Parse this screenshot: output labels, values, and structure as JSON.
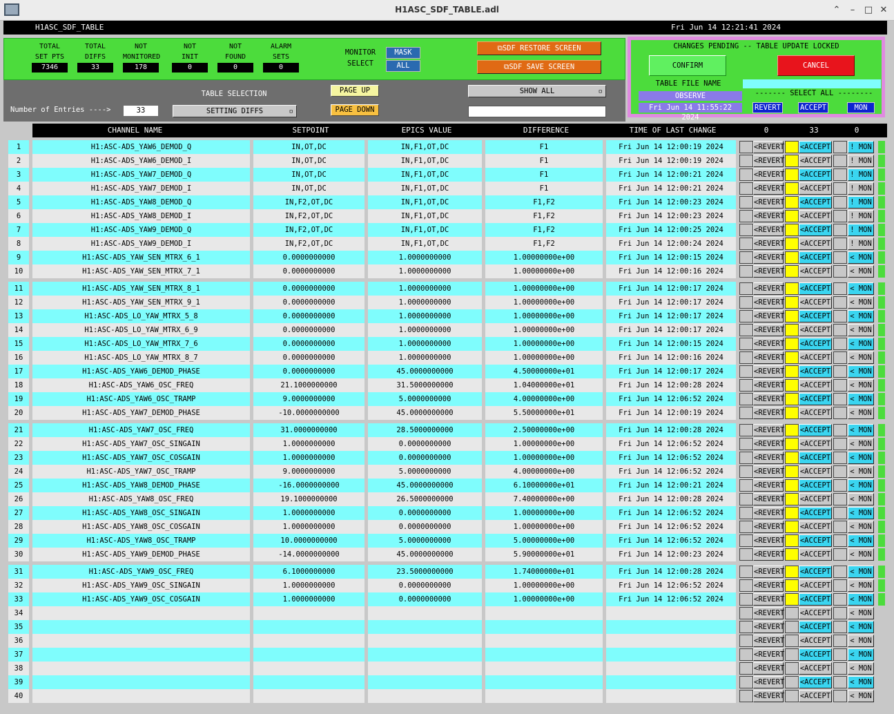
{
  "window": {
    "title": "H1ASC_SDF_TABLE.adl"
  },
  "header": {
    "screen_name": "H1ASC_SDF_TABLE",
    "datetime": "Fri Jun 14 12:21:41 2024"
  },
  "counts": [
    {
      "label1": "TOTAL",
      "label2": "SET PTS",
      "value": "7346"
    },
    {
      "label1": "TOTAL",
      "label2": "DIFFS",
      "value": "33"
    },
    {
      "label1": "NOT",
      "label2": "MONITORED",
      "value": "178"
    },
    {
      "label1": "NOT",
      "label2": "INIT",
      "value": "0"
    },
    {
      "label1": "NOT",
      "label2": "FOUND",
      "value": "0"
    },
    {
      "label1": "ALARM",
      "label2": "SETS",
      "value": "0"
    }
  ],
  "monitor_select": {
    "label1": "MONITOR",
    "label2": "SELECT",
    "mask": "MASK",
    "all": "ALL"
  },
  "sdf_buttons": {
    "restore": "SDF RESTORE SCREEN",
    "save": "SDF SAVE SCREEN"
  },
  "pending": {
    "status": "CHANGES PENDING -- TABLE UPDATE LOCKED",
    "confirm": "CONFIRM",
    "cancel": "CANCEL",
    "file_name_label": "TABLE FILE NAME",
    "file_name_value": "OBSERVE",
    "file_time": "Fri Jun 14 11:55:22 2024",
    "select_all_label": "------- SELECT ALL --------",
    "revert": "REVERT",
    "accept": "ACCEPT",
    "mon": "MON"
  },
  "selection": {
    "entries_label": "Number of Entries ---->",
    "entries_value": "33",
    "table_selection_label": "TABLE SELECTION",
    "table_selection_value": "SETTING DIFFS",
    "page_up": "PAGE UP",
    "page_down": "PAGE DOWN",
    "show_all": "SHOW ALL"
  },
  "table": {
    "headers": {
      "channel": "CHANNEL NAME",
      "setpoint": "SETPOINT",
      "epics": "EPICS VALUE",
      "difference": "DIFFERENCE",
      "time": "TIME OF LAST CHANGE",
      "count_revert": "0",
      "count_accept": "33",
      "count_mon": "0"
    },
    "revert_label": "<REVERT",
    "accept_label": "<ACCEPT",
    "mon_label_bang": "! MON",
    "mon_label_lt": "< MON",
    "colors": {
      "cyan": "#7ffdfd",
      "grey": "#e8e8e8",
      "yellow": "#ffff00",
      "accent_blue": "#3ad5f0",
      "green": "#4cdc3c"
    },
    "rows": [
      {
        "n": "1",
        "ch": "H1:ASC-ADS_YAW6_DEMOD_Q",
        "sp": "IN,OT,DC",
        "ev": "IN,F1,OT,DC",
        "df": "F1",
        "tm": "Fri Jun 14 12:00:19 2024",
        "mon": "bang"
      },
      {
        "n": "2",
        "ch": "H1:ASC-ADS_YAW6_DEMOD_I",
        "sp": "IN,OT,DC",
        "ev": "IN,F1,OT,DC",
        "df": "F1",
        "tm": "Fri Jun 14 12:00:19 2024",
        "mon": "bang"
      },
      {
        "n": "3",
        "ch": "H1:ASC-ADS_YAW7_DEMOD_Q",
        "sp": "IN,OT,DC",
        "ev": "IN,F1,OT,DC",
        "df": "F1",
        "tm": "Fri Jun 14 12:00:21 2024",
        "mon": "bang"
      },
      {
        "n": "4",
        "ch": "H1:ASC-ADS_YAW7_DEMOD_I",
        "sp": "IN,OT,DC",
        "ev": "IN,F1,OT,DC",
        "df": "F1",
        "tm": "Fri Jun 14 12:00:21 2024",
        "mon": "bang"
      },
      {
        "n": "5",
        "ch": "H1:ASC-ADS_YAW8_DEMOD_Q",
        "sp": "IN,F2,OT,DC",
        "ev": "IN,F1,OT,DC",
        "df": "F1,F2",
        "tm": "Fri Jun 14 12:00:23 2024",
        "mon": "bang"
      },
      {
        "n": "6",
        "ch": "H1:ASC-ADS_YAW8_DEMOD_I",
        "sp": "IN,F2,OT,DC",
        "ev": "IN,F1,OT,DC",
        "df": "F1,F2",
        "tm": "Fri Jun 14 12:00:23 2024",
        "mon": "bang"
      },
      {
        "n": "7",
        "ch": "H1:ASC-ADS_YAW9_DEMOD_Q",
        "sp": "IN,F2,OT,DC",
        "ev": "IN,F1,OT,DC",
        "df": "F1,F2",
        "tm": "Fri Jun 14 12:00:25 2024",
        "mon": "bang"
      },
      {
        "n": "8",
        "ch": "H1:ASC-ADS_YAW9_DEMOD_I",
        "sp": "IN,F2,OT,DC",
        "ev": "IN,F1,OT,DC",
        "df": "F1,F2",
        "tm": "Fri Jun 14 12:00:24 2024",
        "mon": "bang"
      },
      {
        "n": "9",
        "ch": "H1:ASC-ADS_YAW_SEN_MTRX_6_1",
        "sp": "0.0000000000",
        "ev": "1.0000000000",
        "df": "1.00000000e+00",
        "tm": "Fri Jun 14 12:00:15 2024",
        "mon": "lt"
      },
      {
        "n": "10",
        "ch": "H1:ASC-ADS_YAW_SEN_MTRX_7_1",
        "sp": "0.0000000000",
        "ev": "1.0000000000",
        "df": "1.00000000e+00",
        "tm": "Fri Jun 14 12:00:16 2024",
        "mon": "lt"
      },
      {
        "n": "11",
        "ch": "H1:ASC-ADS_YAW_SEN_MTRX_8_1",
        "sp": "0.0000000000",
        "ev": "1.0000000000",
        "df": "1.00000000e+00",
        "tm": "Fri Jun 14 12:00:17 2024",
        "mon": "lt"
      },
      {
        "n": "12",
        "ch": "H1:ASC-ADS_YAW_SEN_MTRX_9_1",
        "sp": "0.0000000000",
        "ev": "1.0000000000",
        "df": "1.00000000e+00",
        "tm": "Fri Jun 14 12:00:17 2024",
        "mon": "lt"
      },
      {
        "n": "13",
        "ch": "H1:ASC-ADS_LO_YAW_MTRX_5_8",
        "sp": "0.0000000000",
        "ev": "1.0000000000",
        "df": "1.00000000e+00",
        "tm": "Fri Jun 14 12:00:17 2024",
        "mon": "lt"
      },
      {
        "n": "14",
        "ch": "H1:ASC-ADS_LO_YAW_MTRX_6_9",
        "sp": "0.0000000000",
        "ev": "1.0000000000",
        "df": "1.00000000e+00",
        "tm": "Fri Jun 14 12:00:17 2024",
        "mon": "lt"
      },
      {
        "n": "15",
        "ch": "H1:ASC-ADS_LO_YAW_MTRX_7_6",
        "sp": "0.0000000000",
        "ev": "1.0000000000",
        "df": "1.00000000e+00",
        "tm": "Fri Jun 14 12:00:15 2024",
        "mon": "lt"
      },
      {
        "n": "16",
        "ch": "H1:ASC-ADS_LO_YAW_MTRX_8_7",
        "sp": "0.0000000000",
        "ev": "1.0000000000",
        "df": "1.00000000e+00",
        "tm": "Fri Jun 14 12:00:16 2024",
        "mon": "lt"
      },
      {
        "n": "17",
        "ch": "H1:ASC-ADS_YAW6_DEMOD_PHASE",
        "sp": "0.0000000000",
        "ev": "45.0000000000",
        "df": "4.50000000e+01",
        "tm": "Fri Jun 14 12:00:17 2024",
        "mon": "lt"
      },
      {
        "n": "18",
        "ch": "H1:ASC-ADS_YAW6_OSC_FREQ",
        "sp": "21.1000000000",
        "ev": "31.5000000000",
        "df": "1.04000000e+01",
        "tm": "Fri Jun 14 12:00:28 2024",
        "mon": "lt"
      },
      {
        "n": "19",
        "ch": "H1:ASC-ADS_YAW6_OSC_TRAMP",
        "sp": "9.0000000000",
        "ev": "5.0000000000",
        "df": "4.00000000e+00",
        "tm": "Fri Jun 14 12:06:52 2024",
        "mon": "lt"
      },
      {
        "n": "20",
        "ch": "H1:ASC-ADS_YAW7_DEMOD_PHASE",
        "sp": "-10.0000000000",
        "ev": "45.0000000000",
        "df": "5.50000000e+01",
        "tm": "Fri Jun 14 12:00:19 2024",
        "mon": "lt"
      },
      {
        "n": "21",
        "ch": "H1:ASC-ADS_YAW7_OSC_FREQ",
        "sp": "31.0000000000",
        "ev": "28.5000000000",
        "df": "2.50000000e+00",
        "tm": "Fri Jun 14 12:00:28 2024",
        "mon": "lt"
      },
      {
        "n": "22",
        "ch": "H1:ASC-ADS_YAW7_OSC_SINGAIN",
        "sp": "1.0000000000",
        "ev": "0.0000000000",
        "df": "1.00000000e+00",
        "tm": "Fri Jun 14 12:06:52 2024",
        "mon": "lt"
      },
      {
        "n": "23",
        "ch": "H1:ASC-ADS_YAW7_OSC_COSGAIN",
        "sp": "1.0000000000",
        "ev": "0.0000000000",
        "df": "1.00000000e+00",
        "tm": "Fri Jun 14 12:06:52 2024",
        "mon": "lt"
      },
      {
        "n": "24",
        "ch": "H1:ASC-ADS_YAW7_OSC_TRAMP",
        "sp": "9.0000000000",
        "ev": "5.0000000000",
        "df": "4.00000000e+00",
        "tm": "Fri Jun 14 12:06:52 2024",
        "mon": "lt"
      },
      {
        "n": "25",
        "ch": "H1:ASC-ADS_YAW8_DEMOD_PHASE",
        "sp": "-16.0000000000",
        "ev": "45.0000000000",
        "df": "6.10000000e+01",
        "tm": "Fri Jun 14 12:00:21 2024",
        "mon": "lt"
      },
      {
        "n": "26",
        "ch": "H1:ASC-ADS_YAW8_OSC_FREQ",
        "sp": "19.1000000000",
        "ev": "26.5000000000",
        "df": "7.40000000e+00",
        "tm": "Fri Jun 14 12:00:28 2024",
        "mon": "lt"
      },
      {
        "n": "27",
        "ch": "H1:ASC-ADS_YAW8_OSC_SINGAIN",
        "sp": "1.0000000000",
        "ev": "0.0000000000",
        "df": "1.00000000e+00",
        "tm": "Fri Jun 14 12:06:52 2024",
        "mon": "lt"
      },
      {
        "n": "28",
        "ch": "H1:ASC-ADS_YAW8_OSC_COSGAIN",
        "sp": "1.0000000000",
        "ev": "0.0000000000",
        "df": "1.00000000e+00",
        "tm": "Fri Jun 14 12:06:52 2024",
        "mon": "lt"
      },
      {
        "n": "29",
        "ch": "H1:ASC-ADS_YAW8_OSC_TRAMP",
        "sp": "10.0000000000",
        "ev": "5.0000000000",
        "df": "5.00000000e+00",
        "tm": "Fri Jun 14 12:06:52 2024",
        "mon": "lt"
      },
      {
        "n": "30",
        "ch": "H1:ASC-ADS_YAW9_DEMOD_PHASE",
        "sp": "-14.0000000000",
        "ev": "45.0000000000",
        "df": "5.90000000e+01",
        "tm": "Fri Jun 14 12:00:23 2024",
        "mon": "lt"
      },
      {
        "n": "31",
        "ch": "H1:ASC-ADS_YAW9_OSC_FREQ",
        "sp": "6.1000000000",
        "ev": "23.5000000000",
        "df": "1.74000000e+01",
        "tm": "Fri Jun 14 12:00:28 2024",
        "mon": "lt"
      },
      {
        "n": "32",
        "ch": "H1:ASC-ADS_YAW9_OSC_SINGAIN",
        "sp": "1.0000000000",
        "ev": "0.0000000000",
        "df": "1.00000000e+00",
        "tm": "Fri Jun 14 12:06:52 2024",
        "mon": "lt"
      },
      {
        "n": "33",
        "ch": "H1:ASC-ADS_YAW9_OSC_COSGAIN",
        "sp": "1.0000000000",
        "ev": "0.0000000000",
        "df": "1.00000000e+00",
        "tm": "Fri Jun 14 12:06:52 2024",
        "mon": "lt"
      },
      {
        "n": "34",
        "ch": "",
        "sp": "",
        "ev": "",
        "df": "",
        "tm": "",
        "mon": "lt"
      },
      {
        "n": "35",
        "ch": "",
        "sp": "",
        "ev": "",
        "df": "",
        "tm": "",
        "mon": "lt"
      },
      {
        "n": "36",
        "ch": "",
        "sp": "",
        "ev": "",
        "df": "",
        "tm": "",
        "mon": "lt"
      },
      {
        "n": "37",
        "ch": "",
        "sp": "",
        "ev": "",
        "df": "",
        "tm": "",
        "mon": "lt"
      },
      {
        "n": "38",
        "ch": "",
        "sp": "",
        "ev": "",
        "df": "",
        "tm": "",
        "mon": "lt"
      },
      {
        "n": "39",
        "ch": "",
        "sp": "",
        "ev": "",
        "df": "",
        "tm": "",
        "mon": "lt"
      },
      {
        "n": "40",
        "ch": "",
        "sp": "",
        "ev": "",
        "df": "",
        "tm": "",
        "mon": "lt"
      }
    ]
  }
}
